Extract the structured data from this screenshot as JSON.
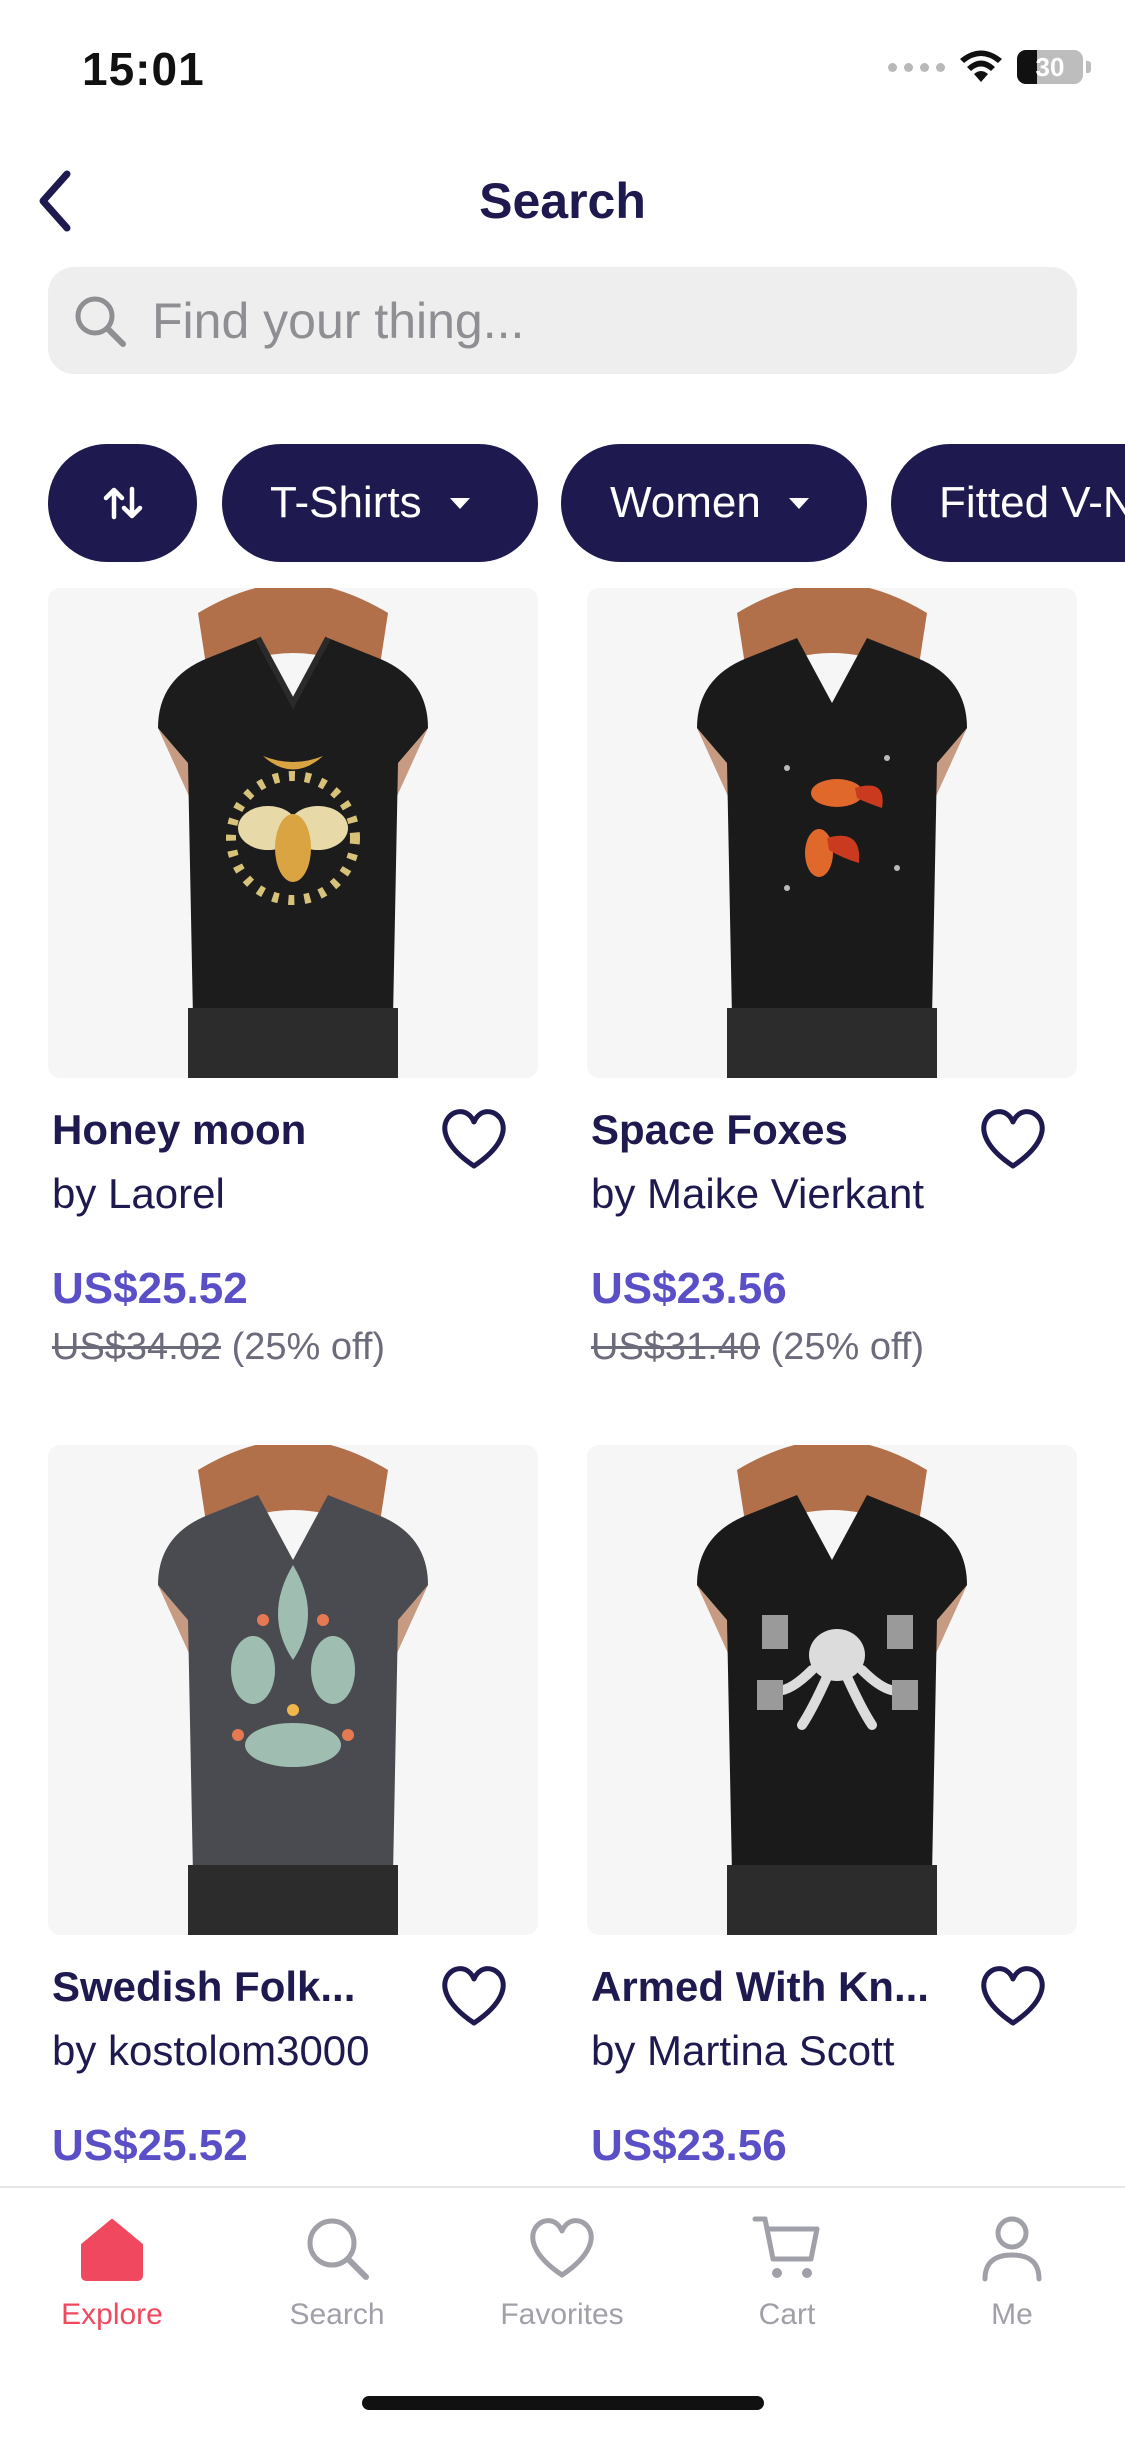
{
  "status_bar": {
    "time": "15:01",
    "battery": "30"
  },
  "header": {
    "title": "Search"
  },
  "search": {
    "placeholder": "Find your thing..."
  },
  "filters": [
    {
      "label": "",
      "icon": "sort-arrows-icon"
    },
    {
      "label": "T-Shirts",
      "icon": "caret-down-icon"
    },
    {
      "label": "Women",
      "icon": "caret-down-icon"
    },
    {
      "label": "Fitted V-Neck",
      "icon": "caret-down-icon"
    }
  ],
  "products": [
    {
      "name": "Honey moon",
      "artist": "by Laorel",
      "price": "US$25.52",
      "original_price": "US$34.02",
      "discount": "(25% off)",
      "shirt_color": "#1c1c1c"
    },
    {
      "name": "Space Foxes",
      "artist": "by Maike Vierkant",
      "price": "US$23.56",
      "original_price": "US$31.40",
      "discount": "(25% off)",
      "shirt_color": "#1a1a1a"
    },
    {
      "name": "Swedish Folk...",
      "artist": "by kostolom3000",
      "price": "US$25.52",
      "original_price": "",
      "discount": "",
      "shirt_color": "#4a4b50"
    },
    {
      "name": "Armed With Kn...",
      "artist": "by Martina Scott",
      "price": "US$23.56",
      "original_price": "",
      "discount": "",
      "shirt_color": "#1a1a1a"
    }
  ],
  "tabbar": [
    {
      "label": "Explore",
      "icon": "home-icon",
      "active": true
    },
    {
      "label": "Search",
      "icon": "search-icon",
      "active": false
    },
    {
      "label": "Favorites",
      "icon": "heart-icon",
      "active": false
    },
    {
      "label": "Cart",
      "icon": "cart-icon",
      "active": false
    },
    {
      "label": "Me",
      "icon": "person-icon",
      "active": false
    }
  ],
  "colors": {
    "navy": "#1e1a4f",
    "price_purple": "#5b4fc7",
    "active_tab": "#f0495f",
    "inactive_tab": "#a0a0a8"
  }
}
